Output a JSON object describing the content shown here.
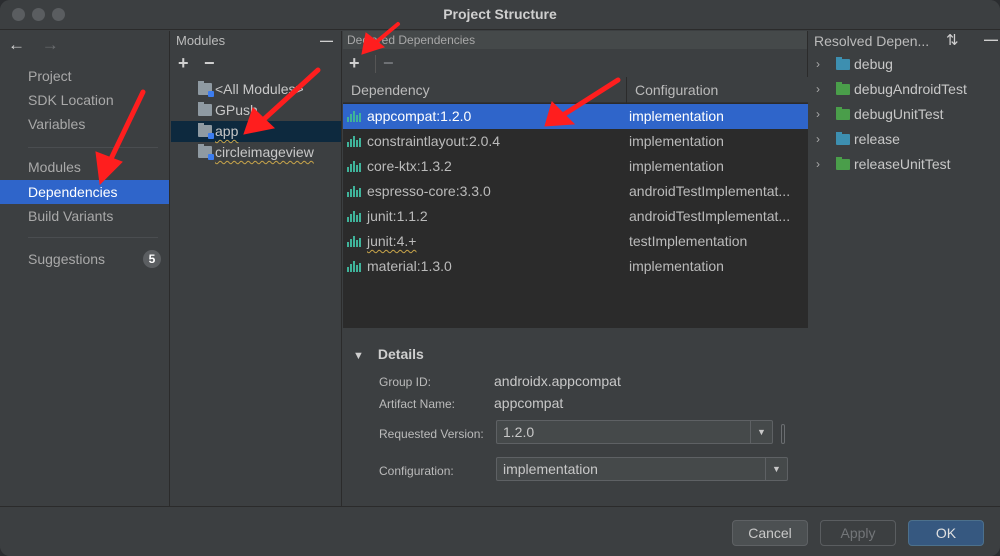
{
  "window": {
    "title": "Project Structure"
  },
  "nav": {
    "back_glyph": "←",
    "forward_glyph": "→",
    "items": [
      {
        "label": "Project"
      },
      {
        "label": "SDK Location"
      },
      {
        "label": "Variables"
      },
      {
        "label": "Modules"
      },
      {
        "label": "Dependencies"
      },
      {
        "label": "Build Variants"
      },
      {
        "label": "Suggestions"
      }
    ],
    "selected": "Dependencies",
    "suggestions_count": "5"
  },
  "modules": {
    "header": "Modules",
    "collapse_glyph": "—",
    "add_glyph": "+",
    "remove_glyph": "−",
    "items": [
      {
        "label": "<All Modules>"
      },
      {
        "label": "GPush"
      },
      {
        "label": "app"
      },
      {
        "label": "circleimageview"
      }
    ],
    "selected": "app"
  },
  "declared": {
    "header": "Declared Dependencies",
    "add_glyph": "+",
    "remove_glyph": "−",
    "columns": [
      "Dependency",
      "Configuration"
    ],
    "rows": [
      {
        "dependency": "appcompat:1.2.0",
        "configuration": "implementation"
      },
      {
        "dependency": "constraintlayout:2.0.4",
        "configuration": "implementation"
      },
      {
        "dependency": "core-ktx:1.3.2",
        "configuration": "implementation"
      },
      {
        "dependency": "espresso-core:3.3.0",
        "configuration": "androidTestImplementat..."
      },
      {
        "dependency": "junit:1.1.2",
        "configuration": "androidTestImplementat..."
      },
      {
        "dependency": "junit:4.+",
        "configuration": "testImplementation"
      },
      {
        "dependency": "material:1.3.0",
        "configuration": "implementation"
      }
    ],
    "selected_row": 0
  },
  "details": {
    "title": "Details",
    "toggle_glyph": "▼",
    "group_id_label": "Group ID:",
    "group_id": "androidx.appcompat",
    "artifact_label": "Artifact Name:",
    "artifact": "appcompat",
    "version_label": "Requested Version:",
    "version": "1.2.0",
    "config_label": "Configuration:",
    "config": "implementation",
    "dropdown_glyph": "▼"
  },
  "resolved": {
    "header": "Resolved Depen...",
    "sort_glyph": "⇅",
    "collapse_glyph": "—",
    "chevron_glyph": "›",
    "items": [
      {
        "label": "debug",
        "color": "#3d8fb0"
      },
      {
        "label": "debugAndroidTest",
        "color": "#4a9e4a"
      },
      {
        "label": "debugUnitTest",
        "color": "#4a9e4a"
      },
      {
        "label": "release",
        "color": "#3d8fb0"
      },
      {
        "label": "releaseUnitTest",
        "color": "#4a9e4a"
      }
    ]
  },
  "buttons": {
    "cancel": "Cancel",
    "apply": "Apply",
    "ok": "OK"
  },
  "colors": {
    "selection": "#2f65ca",
    "annotation_arrow": "#ff1e1e",
    "library_icon": "#3fb39a"
  },
  "annotations": {
    "arrow_count": 4
  }
}
